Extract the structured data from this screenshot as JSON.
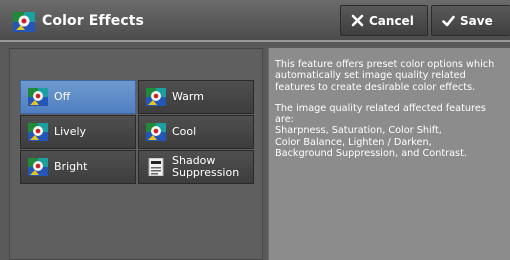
{
  "header": {
    "title": "Color Effects",
    "cancel_label": "Cancel",
    "save_label": "Save",
    "icon": "color-effects-icon"
  },
  "options": [
    {
      "id": "off",
      "label": "Off",
      "icon": "color-effect-icon",
      "selected": true
    },
    {
      "id": "warm",
      "label": "Warm",
      "icon": "color-effect-icon",
      "selected": false
    },
    {
      "id": "lively",
      "label": "Lively",
      "icon": "color-effect-icon",
      "selected": false
    },
    {
      "id": "cool",
      "label": "Cool",
      "icon": "color-effect-icon",
      "selected": false
    },
    {
      "id": "bright",
      "label": "Bright",
      "icon": "color-effect-icon",
      "selected": false
    },
    {
      "id": "shadow-suppression",
      "label_line1": "Shadow",
      "label_line2": "Suppression",
      "icon": "document-icon",
      "selected": false
    }
  ],
  "description": {
    "paragraph1": "This feature offers preset color options which automatically set image quality related features to create desirable color effects.",
    "paragraph2_line1": "The image quality related affected features are:",
    "paragraph2_line2": "Sharpness, Saturation, Color Shift,",
    "paragraph2_line3": "Color Balance, Lighten / Darken,",
    "paragraph2_line4": "Background Suppression, and Contrast."
  },
  "colors": {
    "selected": "#5b8ac9",
    "panel_bg": "#5f5f5f",
    "desc_bg": "#8c8c8c"
  }
}
